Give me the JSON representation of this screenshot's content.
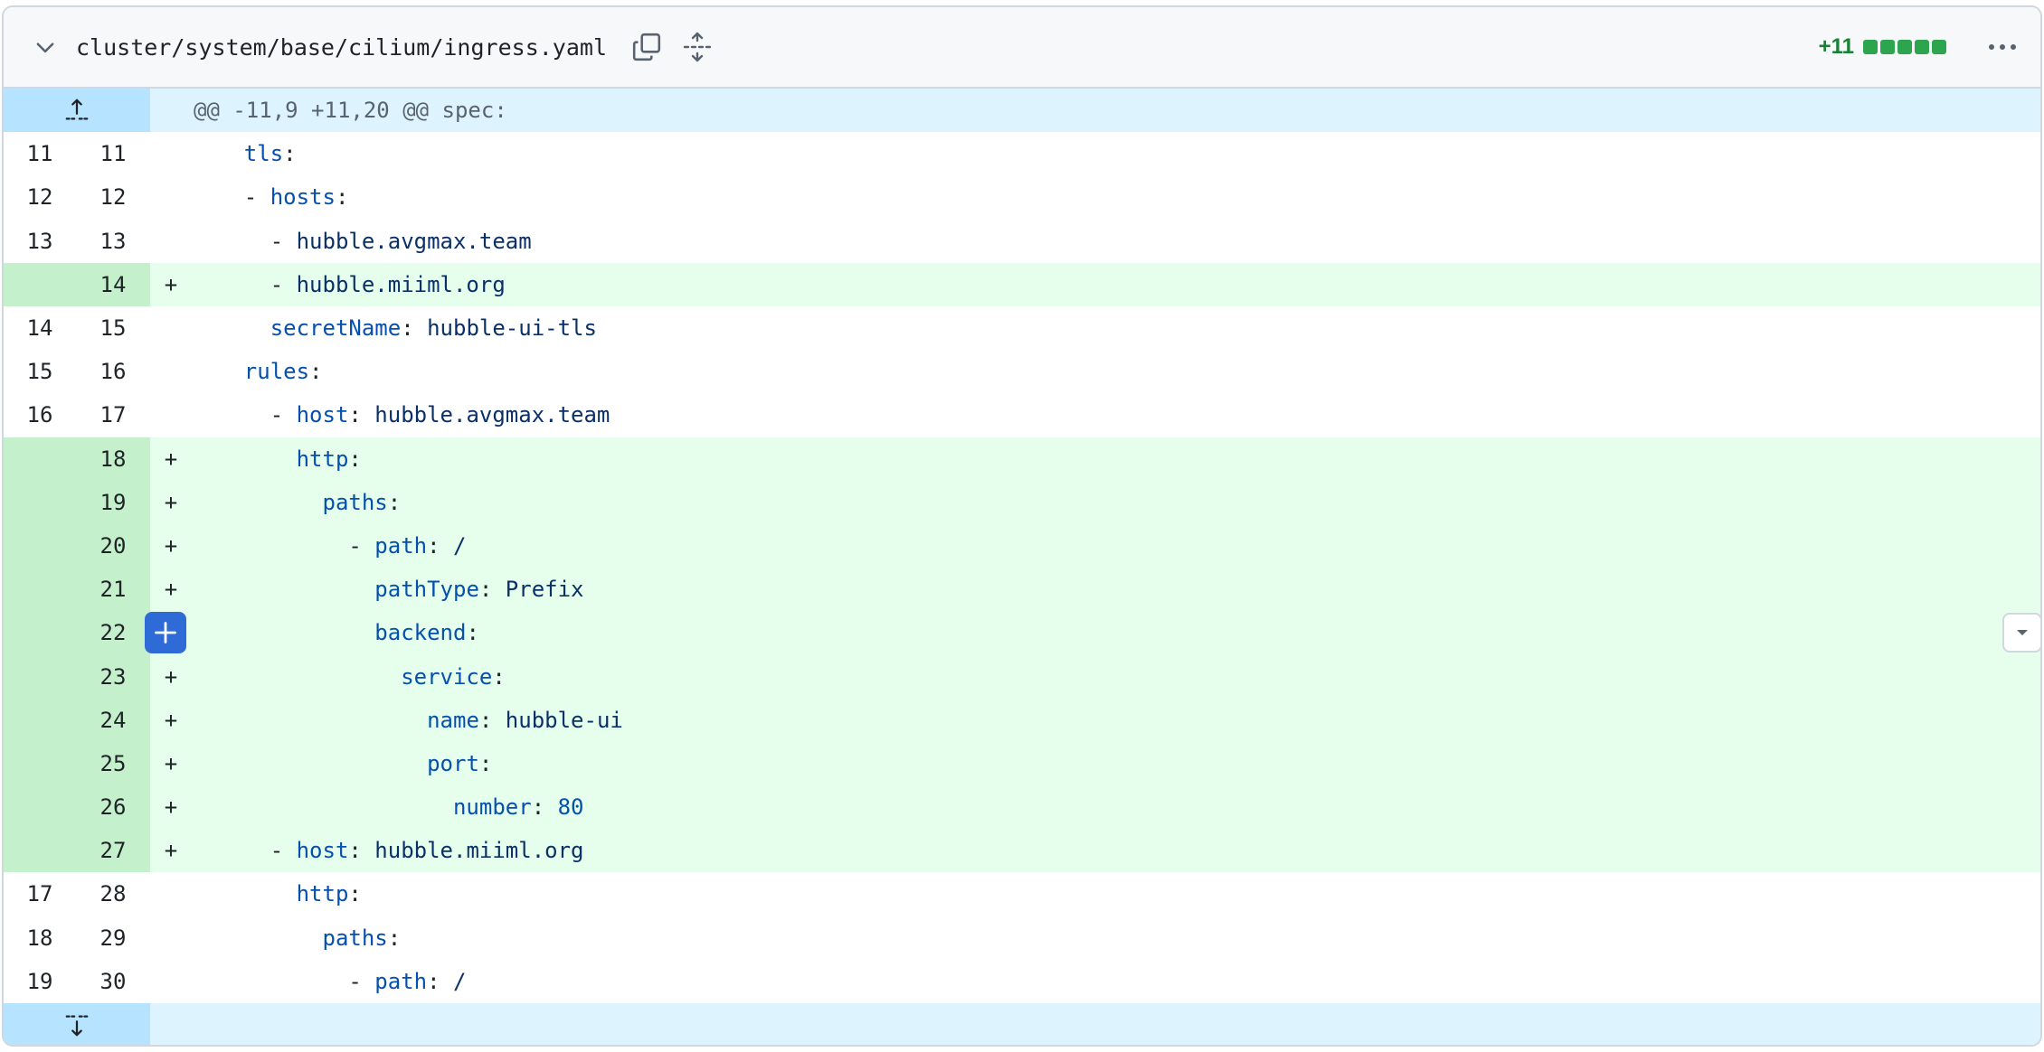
{
  "file": {
    "path": "cluster/system/base/cilium/ingress.yaml",
    "diffstat": "+11",
    "diffstat_blocks": 5
  },
  "hunks": {
    "header": "@@ -11,9 +11,20 @@ spec:"
  },
  "lines": [
    {
      "old": "11",
      "new": "11",
      "marker": "",
      "type": "context",
      "indent": "  ",
      "key": "tls",
      "sep": ":",
      "value": ""
    },
    {
      "old": "12",
      "new": "12",
      "marker": "",
      "type": "context",
      "indent": "  - ",
      "key": "hosts",
      "sep": ":",
      "value": ""
    },
    {
      "old": "13",
      "new": "13",
      "marker": "",
      "type": "context",
      "indent": "    - ",
      "key": "",
      "sep": "",
      "value": "hubble.avgmax.team"
    },
    {
      "old": "",
      "new": "14",
      "marker": "+",
      "type": "add",
      "indent": "    - ",
      "key": "",
      "sep": "",
      "value": "hubble.miiml.org"
    },
    {
      "old": "14",
      "new": "15",
      "marker": "",
      "type": "context",
      "indent": "    ",
      "key": "secretName",
      "sep": ": ",
      "value": "hubble-ui-tls"
    },
    {
      "old": "15",
      "new": "16",
      "marker": "",
      "type": "context",
      "indent": "  ",
      "key": "rules",
      "sep": ":",
      "value": ""
    },
    {
      "old": "16",
      "new": "17",
      "marker": "",
      "type": "context",
      "indent": "    - ",
      "key": "host",
      "sep": ": ",
      "value": "hubble.avgmax.team"
    },
    {
      "old": "",
      "new": "18",
      "marker": "+",
      "type": "add",
      "indent": "      ",
      "key": "http",
      "sep": ":",
      "value": ""
    },
    {
      "old": "",
      "new": "19",
      "marker": "+",
      "type": "add",
      "indent": "        ",
      "key": "paths",
      "sep": ":",
      "value": ""
    },
    {
      "old": "",
      "new": "20",
      "marker": "+",
      "type": "add",
      "indent": "          - ",
      "key": "path",
      "sep": ": ",
      "value": "/"
    },
    {
      "old": "",
      "new": "21",
      "marker": "+",
      "type": "add",
      "indent": "            ",
      "key": "pathType",
      "sep": ": ",
      "value": "Prefix"
    },
    {
      "old": "",
      "new": "22",
      "marker": "+",
      "type": "add",
      "indent": "            ",
      "key": "backend",
      "sep": ":",
      "value": ""
    },
    {
      "old": "",
      "new": "23",
      "marker": "+",
      "type": "add",
      "indent": "              ",
      "key": "service",
      "sep": ":",
      "value": ""
    },
    {
      "old": "",
      "new": "24",
      "marker": "+",
      "type": "add",
      "indent": "                ",
      "key": "name",
      "sep": ": ",
      "value": "hubble-ui"
    },
    {
      "old": "",
      "new": "25",
      "marker": "+",
      "type": "add",
      "indent": "                ",
      "key": "port",
      "sep": ":",
      "value": ""
    },
    {
      "old": "",
      "new": "26",
      "marker": "+",
      "type": "add",
      "indent": "                  ",
      "key": "number",
      "sep": ": ",
      "value": "80",
      "numeric": true
    },
    {
      "old": "",
      "new": "27",
      "marker": "+",
      "type": "add",
      "indent": "    - ",
      "key": "host",
      "sep": ": ",
      "value": "hubble.miiml.org"
    },
    {
      "old": "17",
      "new": "28",
      "marker": "",
      "type": "context",
      "indent": "      ",
      "key": "http",
      "sep": ":",
      "value": ""
    },
    {
      "old": "18",
      "new": "29",
      "marker": "",
      "type": "context",
      "indent": "        ",
      "key": "paths",
      "sep": ":",
      "value": ""
    },
    {
      "old": "19",
      "new": "30",
      "marker": "",
      "type": "context",
      "indent": "          - ",
      "key": "path",
      "sep": ": ",
      "value": "/"
    }
  ],
  "icons": {
    "collapse": "chevron-down-icon",
    "copy": "copy-icon",
    "expand_all": "unfold-icon",
    "more": "kebab-horizontal-icon",
    "expand_up": "fold-up-icon",
    "expand_down": "fold-down-icon",
    "add_comment": "plus-icon",
    "row_menu": "triangle-down-icon"
  },
  "colors": {
    "addition_bg": "#e6ffec",
    "addition_gutter": "#c4f0cc",
    "hunk_bg": "#ddf4ff",
    "hunk_gutter": "#b6e3ff",
    "diffstat_green": "#1a7f37",
    "comment_button": "#2e6bd6"
  }
}
